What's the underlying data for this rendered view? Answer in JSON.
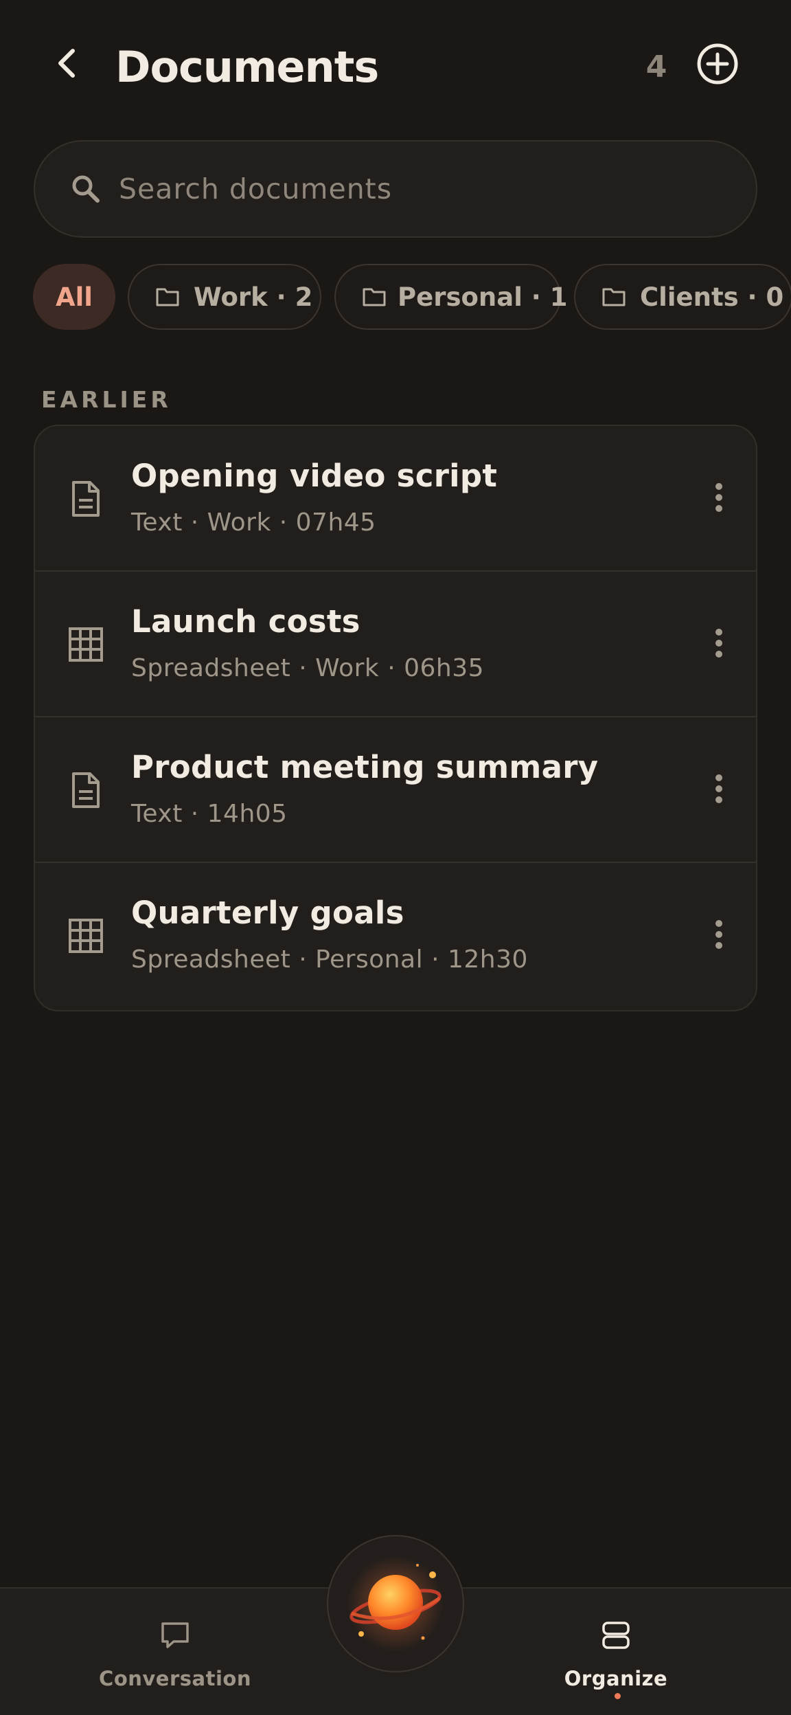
{
  "header": {
    "title": "Documents",
    "count": "4"
  },
  "search": {
    "placeholder": "Search documents",
    "value": ""
  },
  "filters": [
    {
      "label": "All",
      "active": true
    },
    {
      "label": "Work · 2",
      "active": false
    },
    {
      "label": "Personal · 1",
      "active": false
    },
    {
      "label": "Clients · 0",
      "active": false
    }
  ],
  "section": {
    "label": "EARLIER"
  },
  "documents": [
    {
      "title": "Opening video script",
      "meta": "Text · Work · 07h45",
      "icon": "text-document-icon"
    },
    {
      "title": "Launch costs",
      "meta": "Spreadsheet · Work · 06h35",
      "icon": "spreadsheet-icon"
    },
    {
      "title": "Product meeting summary",
      "meta": "Text · 14h05",
      "icon": "text-document-icon"
    },
    {
      "title": "Quarterly goals",
      "meta": "Spreadsheet · Personal · 12h30",
      "icon": "spreadsheet-icon"
    }
  ],
  "nav": {
    "conversation": "Conversation",
    "organize": "Organize",
    "active": "organize"
  },
  "colors": {
    "background": "#1a1714",
    "surface": "#221e1b",
    "accent": "#f0a58c",
    "accent_bg": "#3d2a24",
    "active_dot": "#ee7a58"
  }
}
